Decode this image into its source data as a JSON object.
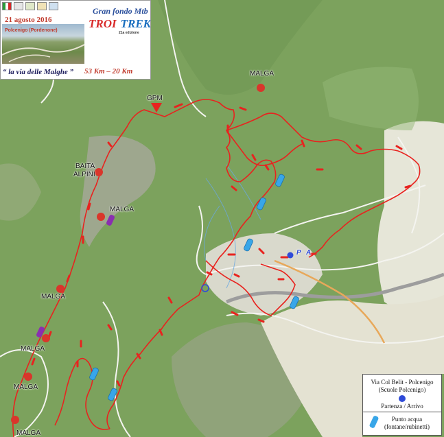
{
  "banner": {
    "date": "21 agosto 2016",
    "place": "Polcenigo (Pordenone)",
    "event_title": "Gran fondo Mtb",
    "brand_part1": "TROI",
    "brand_part2": "TREK",
    "edition": "21a edizione",
    "slogan": "“ la via delle Malghe ”",
    "distances": "53 Km – 20 Km"
  },
  "places": {
    "malga_1": "MALGA",
    "gpm": "GPM",
    "baita_line1": "BAITA",
    "baita_line2": "ALPINI",
    "malga_2": "MALGA",
    "malga_3": "MALGA",
    "malga_4": "MALGA",
    "malga_5": "MALGA",
    "malga_6": "MALGA",
    "start_p": "P",
    "start_a": "A"
  },
  "legend": {
    "location_line1": "Via Col Belit - Polcenigo",
    "location_line2": "(Scuole Polcenigo)",
    "start_label": "Partenza / Arrivo",
    "water_line1": "Punto acqua",
    "water_line2": "(fontane/rubinetti)"
  },
  "colors": {
    "route": "#e8231f",
    "forest": "#7da35e",
    "rock": "#a8a69c",
    "water_icon": "#38a6e8",
    "malga_icon": "#d9362b",
    "purple_icon": "#8a2fb0",
    "start_icon": "#2f4bd8"
  },
  "icons": {
    "malga_marker": "red-circle-icon",
    "gpm_marker": "red-triangle-icon",
    "water_marker": "water-bottle-icon",
    "start_marker": "blue-circle-icon",
    "special_marker": "purple-bottle-icon"
  }
}
